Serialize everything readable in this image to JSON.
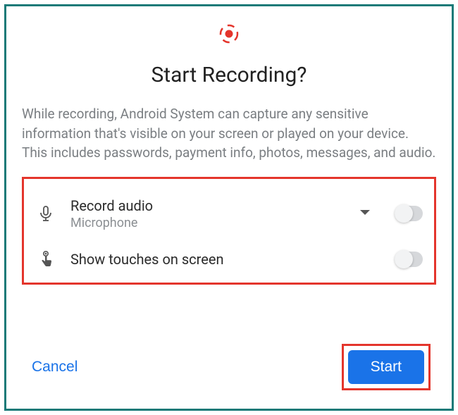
{
  "dialog": {
    "title": "Start Recording?",
    "description": "While recording, Android System can capture any sensitive information that's visible on your screen or played on your device. This includes passwords, payment info, photos, messages, and audio.",
    "options": {
      "record_audio": {
        "title": "Record audio",
        "subtitle": "Microphone",
        "toggle_on": false,
        "has_dropdown": true
      },
      "show_touches": {
        "title": "Show touches on screen",
        "toggle_on": false
      }
    },
    "actions": {
      "cancel": "Cancel",
      "start": "Start"
    }
  },
  "icons": {
    "record": "record-icon",
    "mic": "mic-icon",
    "touch": "touch-icon",
    "dropdown": "chevron-down-icon"
  },
  "colors": {
    "highlight_border": "#e4352c",
    "primary": "#1a73e8",
    "frame": "#1a7a78"
  }
}
